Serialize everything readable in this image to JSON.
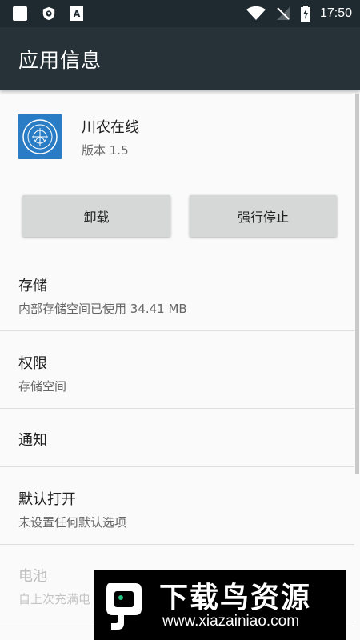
{
  "status_bar": {
    "time": "17:50",
    "icons": [
      "notification-square-icon",
      "shield-icon",
      "a-badge-icon",
      "wifi-icon",
      "no-signal-icon",
      "battery-charging-icon"
    ],
    "a_badge_text": "A"
  },
  "app_bar": {
    "title": "应用信息"
  },
  "app": {
    "name": "川农在线",
    "version": "版本 1.5",
    "icon_color": "#2a7dc4"
  },
  "buttons": {
    "uninstall": "卸载",
    "force_stop": "强行停止"
  },
  "list": [
    {
      "title": "存储",
      "subtitle": "内部存储空间已使用 34.41 MB"
    },
    {
      "title": "权限",
      "subtitle": "存储空间"
    },
    {
      "title": "通知",
      "subtitle": ""
    },
    {
      "title": "默认打开",
      "subtitle": "未设置任何默认选项"
    },
    {
      "title": "电池",
      "subtitle": "自上次充满电"
    }
  ],
  "watermark": {
    "title": "下载鸟资源",
    "url": "www.xiazainiao.com"
  },
  "colors": {
    "status_bar": "#1f2a30",
    "app_bar": "#263238",
    "button": "#d6d7d7"
  }
}
